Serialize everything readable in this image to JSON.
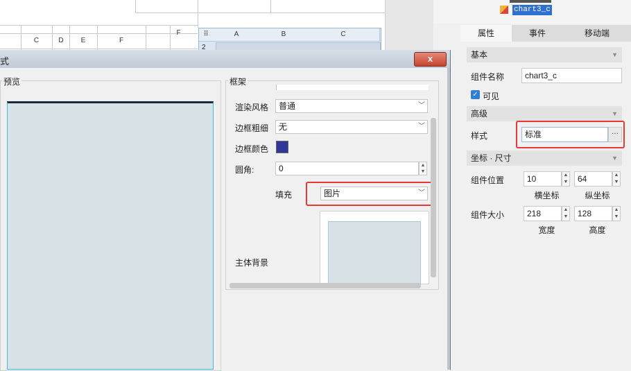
{
  "sheet": {
    "top_cols": [
      "C",
      "D",
      "E",
      "F"
    ],
    "right_col": "F",
    "mini": {
      "cols": [
        "A",
        "B",
        "C"
      ],
      "row": "2"
    }
  },
  "panel": {
    "tree": {
      "selected": "chart3_c"
    },
    "tabs": [
      "属性",
      "事件",
      "移动端"
    ],
    "active_tab": 0,
    "sections": {
      "basic": "基本",
      "advanced": "高级",
      "coords": "坐标 · 尺寸"
    },
    "component_name_label": "组件名称",
    "component_name": "chart3_c",
    "visible_label": "可见",
    "visible_checked": true,
    "style_label": "样式",
    "style_value": "标准",
    "style_btn": "···",
    "position_label": "组件位置",
    "x": "10",
    "y": "64",
    "x_label": "横坐标",
    "y_label": "纵坐标",
    "size_label": "组件大小",
    "width": "218",
    "height": "128",
    "width_label": "宽度",
    "height_label": "高度"
  },
  "dialog": {
    "title": "式",
    "close": "x",
    "preview_label": "预览",
    "frame_label": "框架",
    "render_style_label": "渲染风格",
    "render_style_value": "普通",
    "border_width_label": "边框粗细",
    "border_width_value": "无",
    "border_color_label": "边框颜色",
    "border_color": "#2f3896",
    "radius_label": "圆角:",
    "radius_value": "0",
    "fill_label": "填充",
    "fill_value": "图片",
    "main_bg_label": "主体背景"
  }
}
